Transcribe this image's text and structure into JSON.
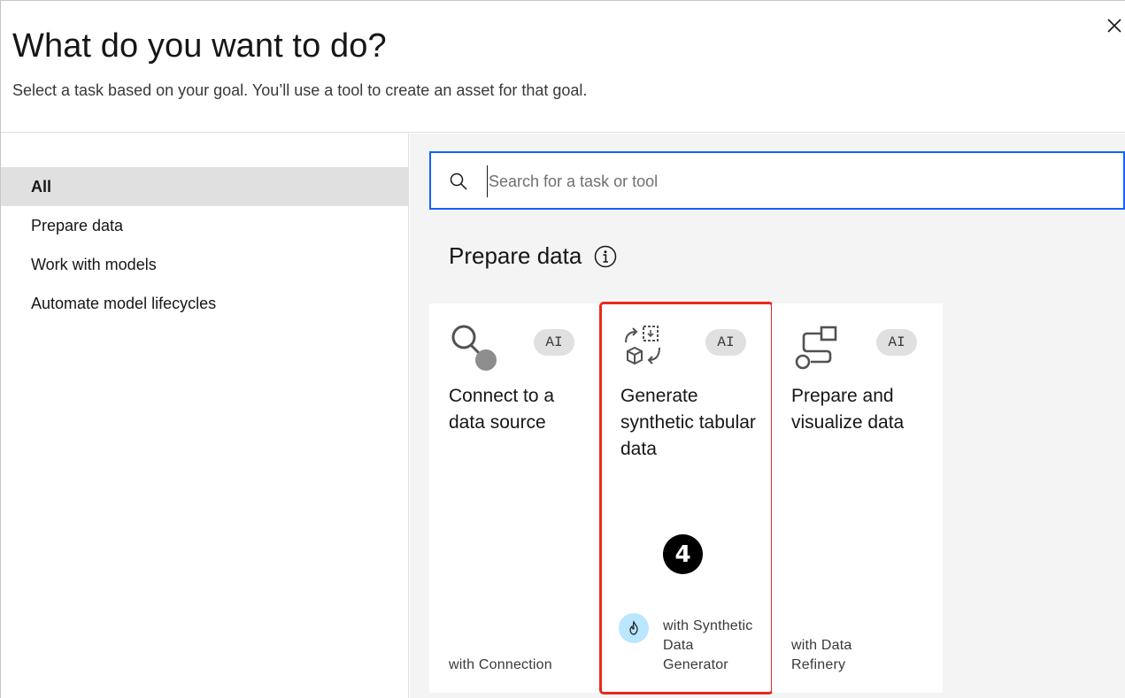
{
  "dialog": {
    "title": "What do you want to do?",
    "subtitle": "Select a task based on your goal. You’ll use a tool to create an asset for that goal."
  },
  "sidebar": {
    "items": [
      {
        "label": "All",
        "active": true
      },
      {
        "label": "Prepare data",
        "active": false
      },
      {
        "label": "Work with models",
        "active": false
      },
      {
        "label": "Automate model lifecycles",
        "active": false
      }
    ]
  },
  "search": {
    "placeholder": "Search for a task or tool",
    "value": ""
  },
  "section": {
    "title": "Prepare data"
  },
  "cards": [
    {
      "title": "Connect to a data source",
      "tag": "AI",
      "tool": "with Connection",
      "icon": "connection-icon"
    },
    {
      "title": "Generate synthetic tabular data",
      "tag": "AI",
      "tool": "with Synthetic Data Generator",
      "icon": "synthetic-data-icon",
      "highlighted": true
    },
    {
      "title": "Prepare and visualize data",
      "tag": "AI",
      "tool": "with Data Refinery",
      "icon": "data-refinery-icon"
    }
  ],
  "annotation": {
    "step": "4"
  },
  "colors": {
    "accent": "#0f62fe",
    "highlight": "#e8291c",
    "panel_bg": "#f4f4f4",
    "tag_bg": "#e0e0e0",
    "avatar_bg": "#bae6ff"
  }
}
